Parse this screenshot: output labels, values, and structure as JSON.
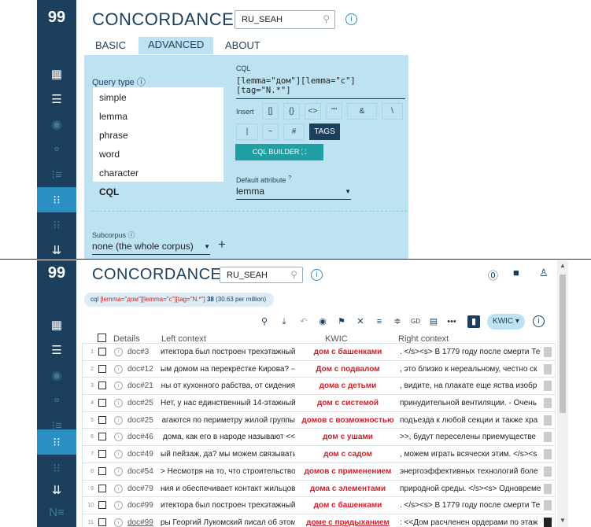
{
  "top": {
    "app_title": "CONCORDANCE",
    "corpus": "RU_SEAH",
    "tabs": [
      {
        "label": "BASIC"
      },
      {
        "label": "ADVANCED"
      },
      {
        "label": "ABOUT"
      }
    ],
    "query_type_label": "Query type",
    "query_types": [
      "simple",
      "lemma",
      "phrase",
      "word",
      "character",
      "CQL"
    ],
    "selected_query_type": "CQL",
    "cql_label": "CQL",
    "cql_value": "[lemma=\"дом\"][lemma=\"с\"][tag=\"N.*\"]",
    "insert_label": "Insert",
    "insert_buttons": [
      "[]",
      "{}",
      "<>",
      "\"\"",
      "&",
      "\\",
      "|",
      "~",
      "#"
    ],
    "tags_label": "TAGS",
    "cql_builder_label": "CQL BUILDER",
    "default_attr_label": "Default attribute",
    "default_attr_value": "lemma",
    "subcorpus_label": "Subcorpus",
    "subcorpus_value": "none (the whole corpus)"
  },
  "bottom": {
    "app_title": "CONCORDANCE",
    "corpus": "RU_SEAH",
    "query_prefix": "cql",
    "query_text": "[lemma=\"дом\"][lemma=\"с\"][tag=\"N.*\"]",
    "hits": "38",
    "per_million": "(30.63 per million)",
    "view_mode": "KWIC",
    "columns": {
      "details": "Details",
      "left": "Left context",
      "kwic": "KWIC",
      "right": "Right context"
    },
    "rows": [
      {
        "n": "1",
        "doc": "doc#3",
        "left": "итектора был построен трехэтажный",
        "kwic": "дом с башенками",
        "right": ". </s><s> В 1779 году после смерти Те"
      },
      {
        "n": "2",
        "doc": "doc#12",
        "left": "ым домом на перекрёстке Кирова? --",
        "kwic": "Дом с подвалом",
        "right": ", это близко к нереальному, честно ск"
      },
      {
        "n": "3",
        "doc": "doc#21",
        "left": "ны от кухонного рабства, от сидения",
        "kwic": "дома с детьми",
        "right": ", видите, на плакате еще яства изобр"
      },
      {
        "n": "4",
        "doc": "doc#25",
        "left": "Нет, у нас единственный 14-этажный",
        "kwic": "дом с системой",
        "right": "принудительной вентиляции. - Очень"
      },
      {
        "n": "5",
        "doc": "doc#25",
        "left": "агаются по периметру жилой группы",
        "kwic": "домов с возможностью",
        "right": "подъезда к любой секции и также хра"
      },
      {
        "n": "6",
        "doc": "doc#46",
        "left": "дома, как его в народе называют <<",
        "kwic": "дом с ушами",
        "right": ">>, будут переселены приемуществе"
      },
      {
        "n": "7",
        "doc": "doc#49",
        "left": "ый пейзаж, да? мы можем связывать",
        "kwic": "дом с садом",
        "right": ", можем играть всячески этим. </s><s"
      },
      {
        "n": "8",
        "doc": "doc#54",
        "left": "> Несмотря на то, что строительство",
        "kwic": "домов с применением",
        "right": "энергоэффективных технологий боле"
      },
      {
        "n": "9",
        "doc": "doc#79",
        "left": "ния и обеспечивает контакт жильцов",
        "kwic": "дома с элементами",
        "right": "природной среды. </s><s> Одновремен"
      },
      {
        "n": "10",
        "doc": "doc#99",
        "left": "итектора был построен трехэтажный",
        "kwic": "дом с башенками",
        "right": ". </s><s> В 1779 году после смерти Те"
      },
      {
        "n": "11",
        "doc": "doc#99",
        "left": "ры Георгий Лукомский писал об этом",
        "kwic": "доме с придыханием",
        "right": ": <<Дом расчленен ордерами по этаж"
      }
    ]
  }
}
